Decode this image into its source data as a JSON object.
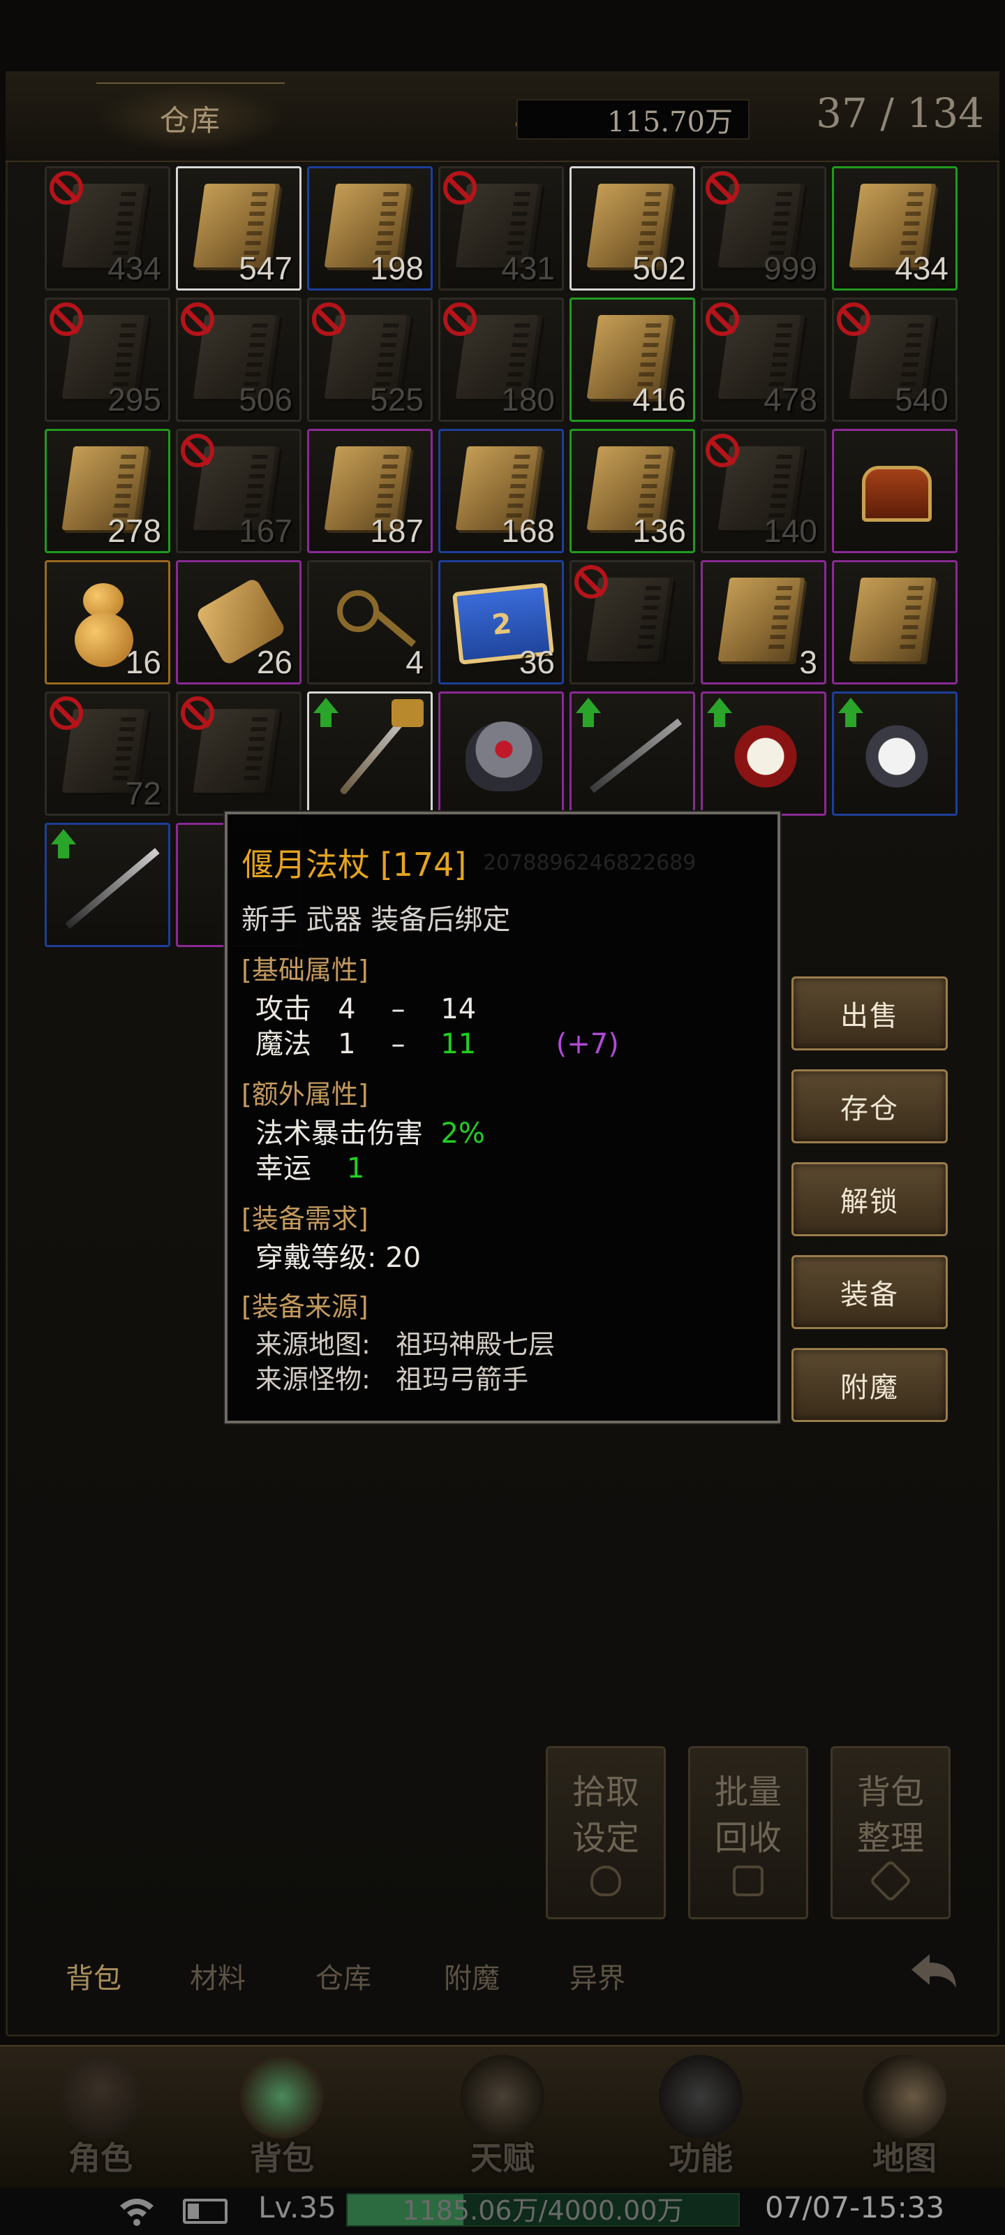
{
  "header": {
    "title": "仓库",
    "gold": "115.70万",
    "capacity": "37 / 134"
  },
  "grid": [
    {
      "count": "434",
      "locked": true
    },
    {
      "count": "547",
      "locked": false
    },
    {
      "count": "198",
      "locked": false
    },
    {
      "count": "431",
      "locked": true
    },
    {
      "count": "502",
      "locked": false
    },
    {
      "count": "999",
      "locked": true
    },
    {
      "count": "434",
      "locked": false
    },
    {
      "count": "295",
      "locked": true
    },
    {
      "count": "506",
      "locked": true
    },
    {
      "count": "525",
      "locked": true
    },
    {
      "count": "180",
      "locked": true
    },
    {
      "count": "416",
      "locked": false
    },
    {
      "count": "478",
      "locked": true
    },
    {
      "count": "540",
      "locked": true
    },
    {
      "count": "278",
      "locked": false
    },
    {
      "count": "167",
      "locked": true
    },
    {
      "count": "187",
      "locked": false
    },
    {
      "count": "168",
      "locked": false
    },
    {
      "count": "136",
      "locked": false
    },
    {
      "count": "140",
      "locked": true
    },
    {
      "count": "",
      "locked": false
    },
    {
      "count": "16",
      "locked": false
    },
    {
      "count": "26",
      "locked": false
    },
    {
      "count": "4",
      "locked": false
    },
    {
      "count": "36",
      "locked": false
    },
    {
      "count": "",
      "locked": true
    },
    {
      "count": "3",
      "locked": false
    },
    {
      "count": "",
      "locked": false
    },
    {
      "count": "72",
      "locked": true
    },
    {
      "count": "",
      "locked": true
    },
    {
      "count": "",
      "locked": false
    },
    {
      "count": "",
      "locked": false
    },
    {
      "count": "",
      "locked": false
    },
    {
      "count": "",
      "locked": false
    },
    {
      "count": "",
      "locked": false
    },
    {
      "count": "",
      "locked": false
    }
  ],
  "map_scroll_label": "2",
  "tooltip": {
    "name": "偃月法杖 [174]",
    "id": "2078896246822689",
    "tags": "新手 武器 装备后绑定",
    "section_base": "[基础属性]",
    "attack_label": "攻击",
    "attack_min": "4",
    "attack_dash": "–",
    "attack_max": "14",
    "magic_label": "魔法",
    "magic_min": "1",
    "magic_dash": "–",
    "magic_max": "11",
    "magic_bonus": "(+7)",
    "section_extra": "[额外属性]",
    "spell_crit_label": "法术暴击伤害",
    "spell_crit_value": "2%",
    "luck_label": "幸运",
    "luck_value": "1",
    "section_require": "[装备需求]",
    "level_req": "穿戴等级: 20",
    "section_source": "[装备来源]",
    "source_map_label": "来源地图:",
    "source_map": "祖玛神殿七层",
    "source_monster_label": "来源怪物:",
    "source_monster": "祖玛弓箭手"
  },
  "actions": {
    "sell": "出售",
    "store": "存仓",
    "unlock": "解锁",
    "equip": "装备",
    "enchant": "附魔"
  },
  "utility": {
    "pickup_line1": "拾取",
    "pickup_line2": "设定",
    "recycle_line1": "批量",
    "recycle_line2": "回收",
    "sort_line1": "背包",
    "sort_line2": "整理"
  },
  "subtabs": [
    "背包",
    "材料",
    "仓库",
    "附魔",
    "异界"
  ],
  "nav": [
    "角色",
    "背包",
    "天赋",
    "功能",
    "地图"
  ],
  "status": {
    "level": "Lv.35",
    "exp_text": "1185.06万/4000.00万",
    "exp_fraction": 0.296,
    "datetime": "07/07-15:33"
  },
  "colors": {
    "accent_gold": "#e6a420",
    "stat_green": "#20d020",
    "bonus_purple": "#b04ad8",
    "section_tan": "#c49a5e"
  }
}
